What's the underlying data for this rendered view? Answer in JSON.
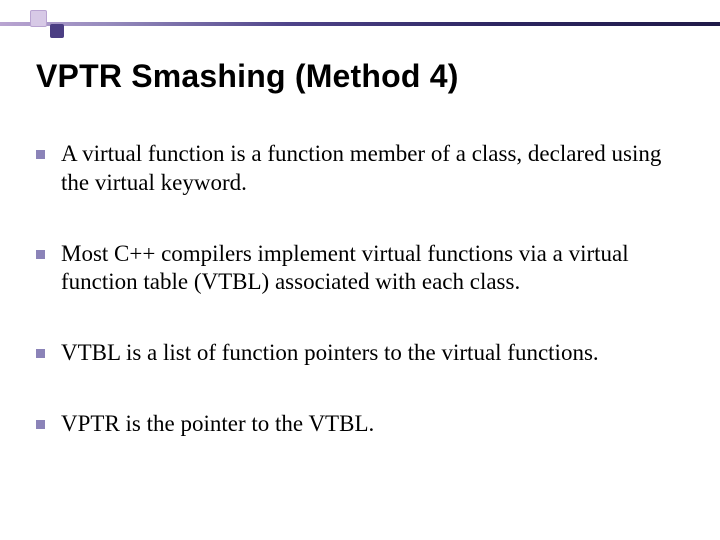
{
  "title": "VPTR Smashing (Method 4)",
  "bullets": [
    "A virtual function is a function member of a class, declared using the virtual keyword.",
    "Most C++ compilers implement virtual functions via a virtual function table (VTBL) associated with each class.",
    "VTBL is a list of function pointers to the virtual functions.",
    "VPTR is the pointer to the VTBL."
  ]
}
